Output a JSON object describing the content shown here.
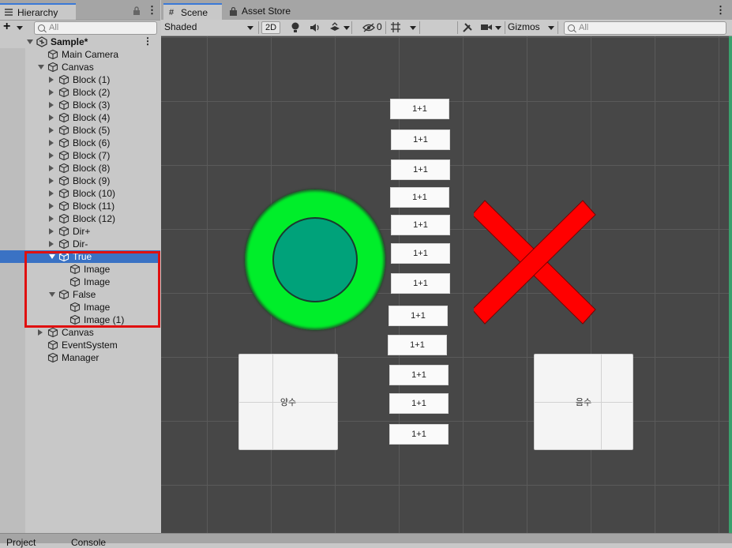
{
  "hierarchy": {
    "tab_label": "Hierarchy",
    "search_placeholder": "All",
    "rows": [
      {
        "label": "Sample*",
        "kind": "scene",
        "depth": 0,
        "fold": "down"
      },
      {
        "label": "Main Camera",
        "kind": "object",
        "depth": 1,
        "fold": "none"
      },
      {
        "label": "Canvas",
        "kind": "object",
        "depth": 1,
        "fold": "down"
      },
      {
        "label": "Block (1)",
        "kind": "object",
        "depth": 2,
        "fold": "right"
      },
      {
        "label": "Block (2)",
        "kind": "object",
        "depth": 2,
        "fold": "right"
      },
      {
        "label": "Block (3)",
        "kind": "object",
        "depth": 2,
        "fold": "right"
      },
      {
        "label": "Block (4)",
        "kind": "object",
        "depth": 2,
        "fold": "right"
      },
      {
        "label": "Block (5)",
        "kind": "object",
        "depth": 2,
        "fold": "right"
      },
      {
        "label": "Block (6)",
        "kind": "object",
        "depth": 2,
        "fold": "right"
      },
      {
        "label": "Block (7)",
        "kind": "object",
        "depth": 2,
        "fold": "right"
      },
      {
        "label": "Block (8)",
        "kind": "object",
        "depth": 2,
        "fold": "right"
      },
      {
        "label": "Block (9)",
        "kind": "object",
        "depth": 2,
        "fold": "right"
      },
      {
        "label": "Block (10)",
        "kind": "object",
        "depth": 2,
        "fold": "right"
      },
      {
        "label": "Block (11)",
        "kind": "object",
        "depth": 2,
        "fold": "right"
      },
      {
        "label": "Block (12)",
        "kind": "object",
        "depth": 2,
        "fold": "right"
      },
      {
        "label": "Dir+",
        "kind": "object",
        "depth": 2,
        "fold": "right"
      },
      {
        "label": "Dir-",
        "kind": "object",
        "depth": 2,
        "fold": "right"
      },
      {
        "label": "True",
        "kind": "object",
        "depth": 2,
        "fold": "down",
        "selected": true
      },
      {
        "label": "Image",
        "kind": "object",
        "depth": 3,
        "fold": "none"
      },
      {
        "label": "Image",
        "kind": "object",
        "depth": 3,
        "fold": "none"
      },
      {
        "label": "False",
        "kind": "object",
        "depth": 2,
        "fold": "down"
      },
      {
        "label": "Image",
        "kind": "object",
        "depth": 3,
        "fold": "none"
      },
      {
        "label": "Image (1)",
        "kind": "object",
        "depth": 3,
        "fold": "none"
      },
      {
        "label": "Canvas",
        "kind": "object",
        "depth": 1,
        "fold": "right"
      },
      {
        "label": "EventSystem",
        "kind": "object",
        "depth": 1,
        "fold": "none"
      },
      {
        "label": "Manager",
        "kind": "object",
        "depth": 1,
        "fold": "none"
      }
    ]
  },
  "scene": {
    "tabs": [
      "Scene",
      "Asset Store"
    ],
    "toolbar": {
      "shading_mode": "Shaded",
      "mode_2d": "2D",
      "hidden_count": "0",
      "gizmos": "Gizmos",
      "search_placeholder": "All"
    },
    "blocks": [
      "1+1",
      "1+1",
      "1+1",
      "1+1",
      "1+1",
      "1+1",
      "1+1",
      "1+1",
      "1+1",
      "1+1",
      "1+1",
      "1+1"
    ],
    "left_panel_label": "양수",
    "right_panel_label": "음수",
    "colors": {
      "correct_ring": "#00ee2a",
      "correct_core": "#00a27a",
      "wrong_cross": "#ff0000",
      "viewport_bg": "#474747",
      "selection": "#3a72c4",
      "highlight_box": "#e01010"
    }
  },
  "bottom_tabs": [
    "Project",
    "Console"
  ]
}
